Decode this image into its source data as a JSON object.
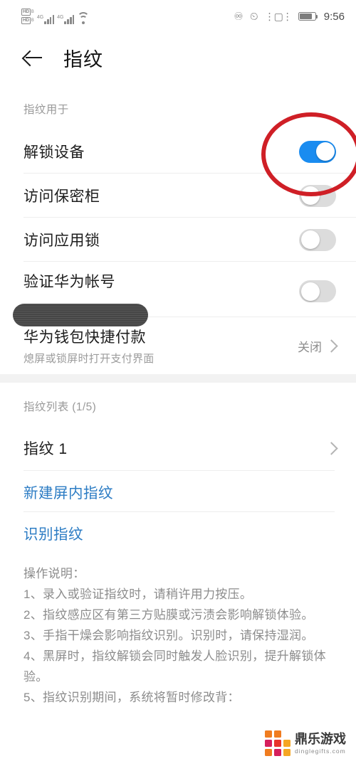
{
  "statusbar": {
    "hd_label_1": "HD",
    "hd_sub_1": "B",
    "hd_label_2": "HD",
    "hd_sub_2": "B",
    "network_1": "4G",
    "network_2": "4G",
    "wifi_icon": "wifi-icon",
    "headset_icon": "෴",
    "alarm_icon": "⏱",
    "vibrate_icon": "vibrate-icon",
    "battery_icon": "battery-icon",
    "time": "9:56"
  },
  "header": {
    "back_icon": "back-arrow-icon",
    "title": "指纹"
  },
  "usage_section": {
    "label": "指纹用于",
    "items": [
      {
        "label": "解锁设备",
        "toggle": "on"
      },
      {
        "label": "访问保密柜",
        "toggle": "off"
      },
      {
        "label": "访问应用锁",
        "toggle": "off"
      },
      {
        "label": "验证华为帐号",
        "toggle": "off"
      }
    ],
    "wallet": {
      "label": "华为钱包快捷付款",
      "sub": "熄屏或锁屏时打开支付界面",
      "value": "关闭",
      "chevron_icon": "chevron-right-icon"
    }
  },
  "list_section": {
    "label": "指纹列表 (1/5)",
    "items": [
      {
        "label": "指纹 1",
        "chevron_icon": "chevron-right-icon"
      }
    ],
    "actions": [
      {
        "label": "新建屏内指纹"
      },
      {
        "label": "识别指纹"
      }
    ]
  },
  "instructions": {
    "heading": "操作说明：",
    "lines": [
      "1、录入或验证指纹时，请稍许用力按压。",
      "2、指纹感应区有第三方贴膜或污渍会影响解锁体验。",
      "3、手指干燥会影响指纹识别。识别时，请保持湿润。",
      "4、黑屏时，指纹解锁会同时触发人脸识别，提升解锁体验。",
      "5、指纹识别期间，系统将暂时修改背："
    ]
  },
  "annotation": {
    "shape": "ellipse",
    "color": "#cf1f26",
    "target": "unlock-device-toggle"
  },
  "watermark": {
    "cn": "鼎乐游戏",
    "en": "dinglegifts.com",
    "colors": [
      "#f07c1f",
      "#f07c1f",
      "#e8332a",
      "#d61f5c",
      "#f5a623",
      "#f07c1f",
      "#f07c1f",
      "#d61f5c",
      "#f5a623"
    ]
  },
  "theme": {
    "accent_on": "#1a8cf0",
    "toggle_off": "#dcdcdc",
    "link": "#2c7cc4",
    "annotation_red": "#cf1f26"
  }
}
